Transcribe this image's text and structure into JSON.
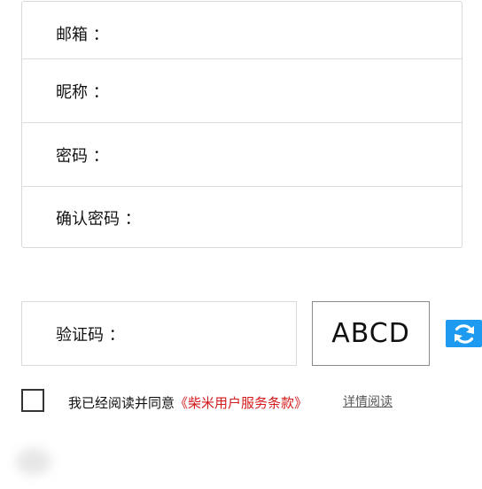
{
  "form": {
    "email": {
      "label": "邮箱 ：",
      "value": ""
    },
    "nickname": {
      "label": "昵称 ：",
      "value": ""
    },
    "password": {
      "label": "密码 ：",
      "value": ""
    },
    "confirm_password": {
      "label": "确认密码 ：",
      "value": ""
    }
  },
  "captcha": {
    "label": "验证码 ：",
    "value": "",
    "image_text": "ABCD",
    "refresh_icon": "refresh-icon"
  },
  "agreement": {
    "prefix": "我已经阅读并同意",
    "terms": "《柴米用户服务条款》",
    "detail_link": "详情阅读",
    "checked": false
  },
  "colors": {
    "terms_link": "#d41a1a",
    "refresh_button": "#1e9bf0"
  }
}
